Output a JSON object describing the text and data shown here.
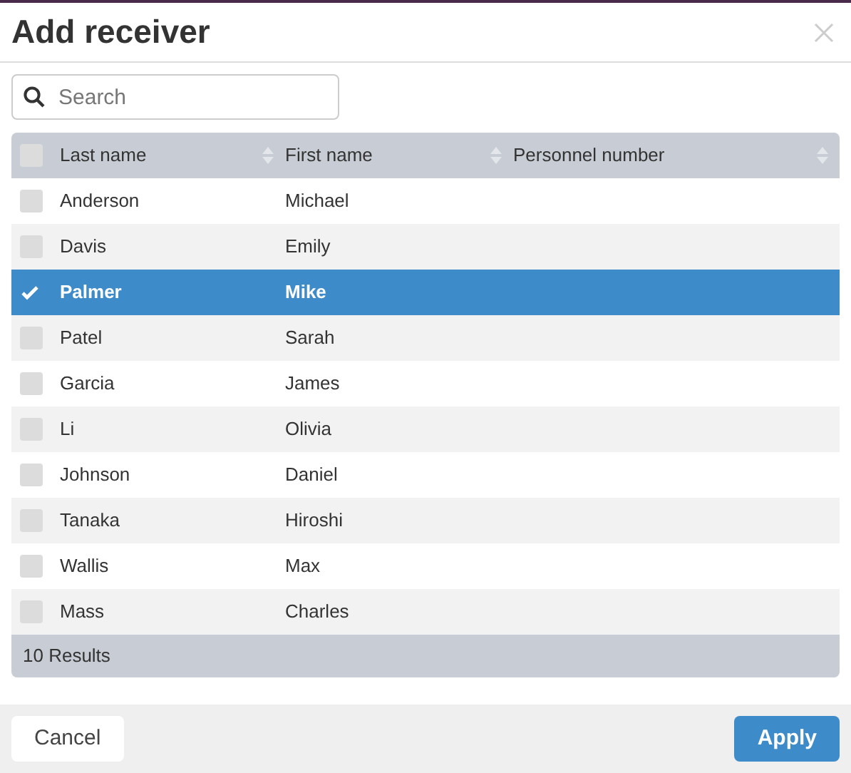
{
  "dialog": {
    "title": "Add receiver"
  },
  "search": {
    "placeholder": "Search"
  },
  "table": {
    "header_checkbox": {
      "checked": false
    },
    "columns": [
      "Last name",
      "First name",
      "Personnel number"
    ],
    "rows": [
      {
        "cells": [
          "Anderson",
          "Michael"
        ],
        "selected": false
      },
      {
        "cells": [
          "Davis",
          "Emily"
        ],
        "selected": false
      },
      {
        "cells": [
          "Palmer",
          "Mike"
        ],
        "selected": true
      },
      {
        "cells": [
          "Patel",
          "Sarah"
        ],
        "selected": false
      },
      {
        "cells": [
          "Garcia",
          "James"
        ],
        "selected": false
      },
      {
        "cells": [
          "Li",
          "Olivia"
        ],
        "selected": false
      },
      {
        "cells": [
          "Johnson",
          "Daniel"
        ],
        "selected": false
      },
      {
        "cells": [
          "Tanaka",
          "Hiroshi"
        ],
        "selected": false
      },
      {
        "cells": [
          "Wallis",
          "Max"
        ],
        "selected": false
      },
      {
        "cells": [
          "Mass",
          "Charles"
        ],
        "selected": false
      }
    ],
    "footer": "10 Results"
  },
  "buttons": {
    "cancel": "Cancel",
    "apply": "Apply"
  }
}
